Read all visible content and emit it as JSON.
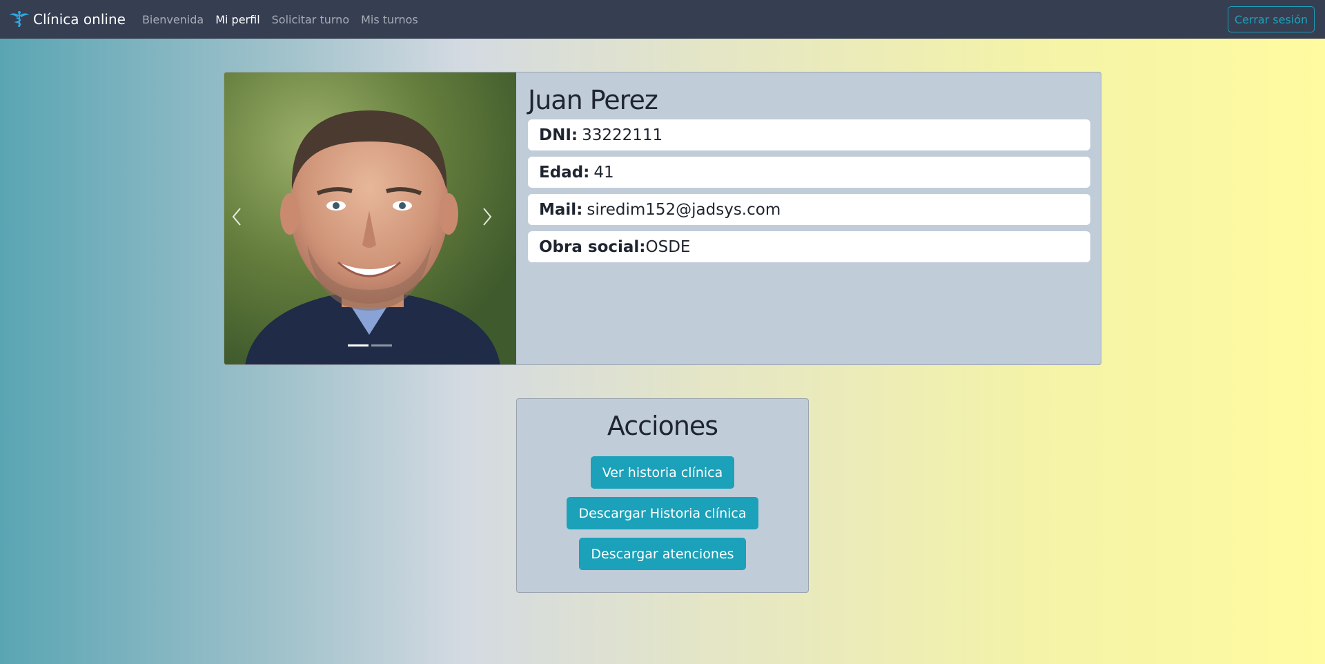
{
  "navbar": {
    "brand": "Clínica online",
    "links": [
      "Bienvenida",
      "Mi perfil",
      "Solicitar turno",
      "Mis turnos"
    ],
    "active_link": "Mi perfil",
    "logout": "Cerrar sesión"
  },
  "profile": {
    "name": "Juan Perez",
    "fields": [
      {
        "label": "DNI:",
        "value": "33222111"
      },
      {
        "label": "Edad:",
        "value": "41"
      },
      {
        "label": "Mail:",
        "value": "siredim152@jadsys.com"
      },
      {
        "label": "Obra social:",
        "value": "OSDE"
      }
    ],
    "carousel": {
      "slide_count": 2,
      "active_index": 0
    }
  },
  "actions": {
    "title": "Acciones",
    "buttons": [
      "Ver historia clínica",
      "Descargar Historia clínica",
      "Descargar atenciones"
    ]
  },
  "colors": {
    "navbar_bg": "#363e52",
    "accent": "#1ba1b9",
    "card_bg": "#c1ccd9"
  },
  "icons": {
    "brand": "caduceus-icon",
    "carousel_prev": "chevron-left-icon",
    "carousel_next": "chevron-right-icon"
  }
}
